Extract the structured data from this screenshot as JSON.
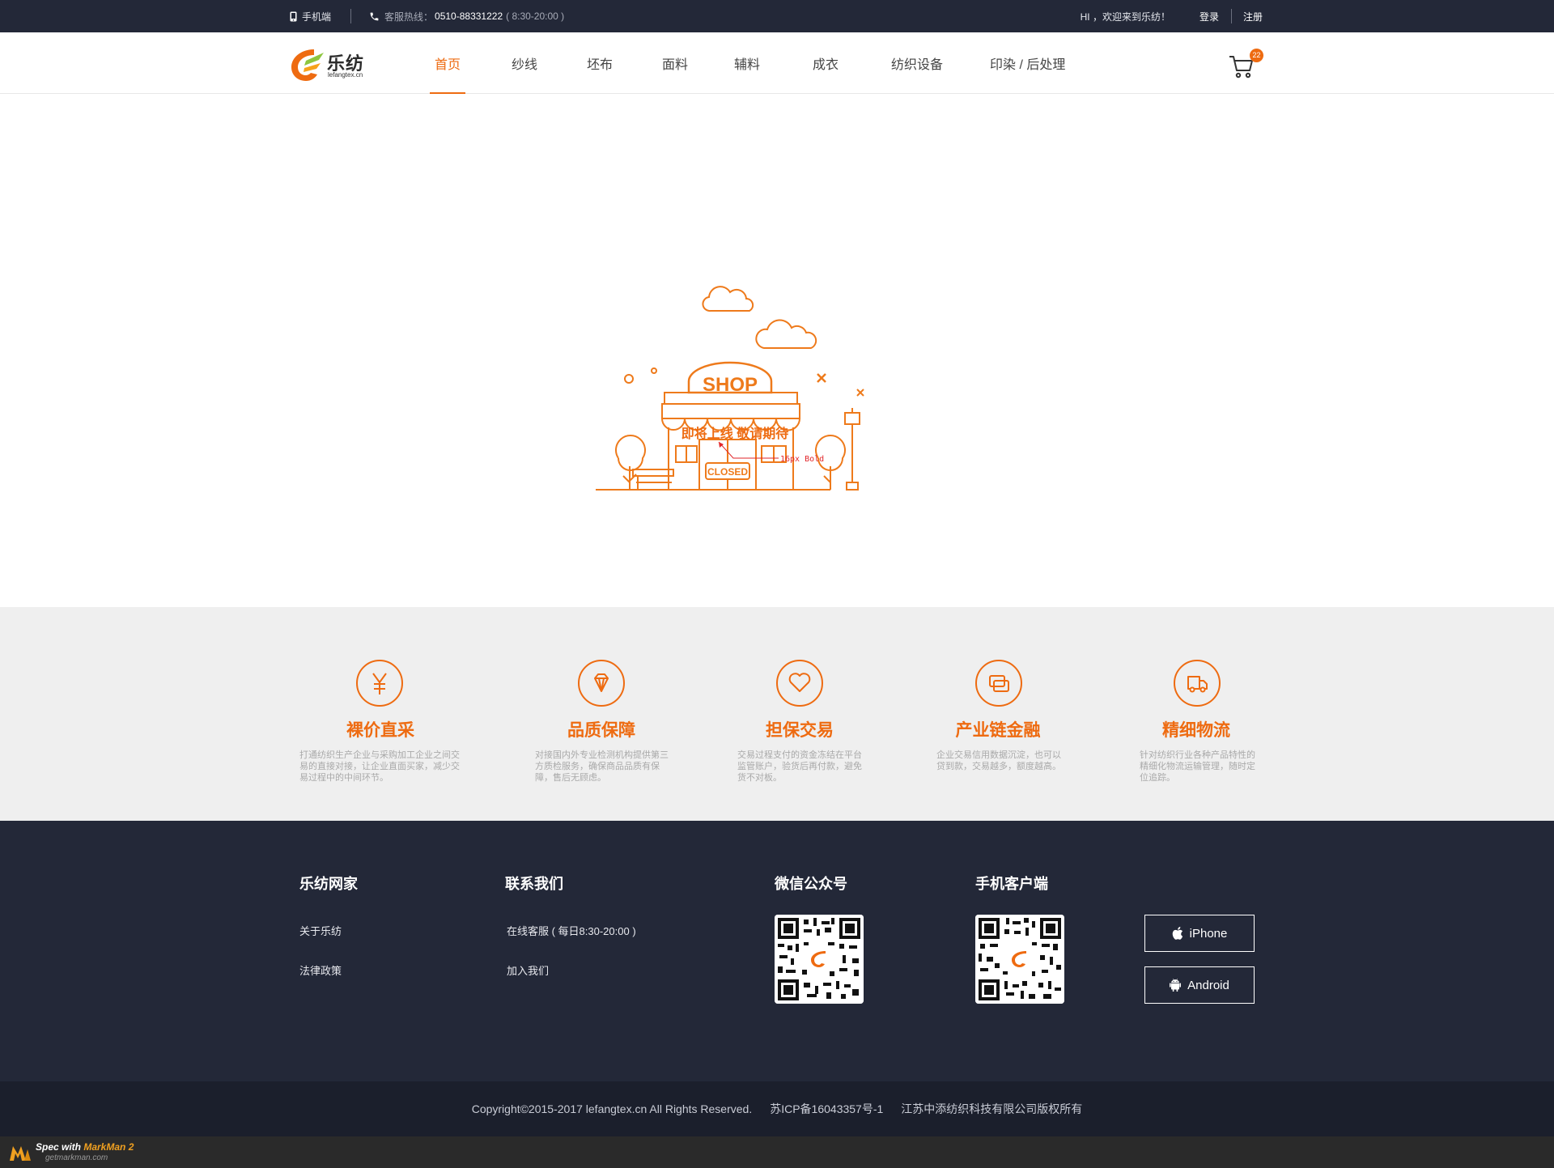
{
  "topbar": {
    "mobile_label": "手机端",
    "hotline_label": "客服热线：",
    "hotline_number": "0510-88331222",
    "hotline_hours": "( 8:30-20:00 )",
    "welcome": "HI ，欢迎来到乐纺！",
    "login": "登录",
    "register": "注册"
  },
  "header": {
    "logo_cn": "乐纺",
    "logo_en": "lefangtex.cn",
    "nav": [
      "首页",
      "纱线",
      "坯布",
      "面料",
      "辅料",
      "成衣",
      "纺织设备",
      "印染 / 后处理"
    ],
    "active_nav": "首页",
    "cart_count": "22"
  },
  "main": {
    "shop_sign": "SHOP",
    "closed_sign": "CLOSED",
    "coming_soon": "即将上线 敬请期待",
    "annotation": "16px Bold"
  },
  "features": [
    {
      "title": "裸价直采",
      "desc": "打通纺织生产企业与采购加工企业之间交易的直接对接，让企业直面买家，减少交易过程中的中间环节。",
      "icon": "yen-icon"
    },
    {
      "title": "品质保障",
      "desc": "对接国内外专业检测机构提供第三方质检服务，确保商品品质有保障，售后无顾虑。",
      "icon": "diamond-icon"
    },
    {
      "title": "担保交易",
      "desc": "交易过程支付的资金冻结在平台监管账户，验货后再付款，避免货不对板。",
      "icon": "heart-icon"
    },
    {
      "title": "产业链金融",
      "desc": "企业交易信用数据沉淀，也可以贷到款，交易越多，额度越高。",
      "icon": "finance-icon"
    },
    {
      "title": "精细物流",
      "desc": "针对纺织行业各种产品特性的精细化物流运输管理，随时定位追踪。",
      "icon": "truck-icon"
    }
  ],
  "footer": {
    "col1_title": "乐纺网家",
    "col1_links": [
      "关于乐纺",
      "法律政策"
    ],
    "col2_title": "联系我们",
    "col2_links": [
      "在线客服 ( 每日8:30-20:00 )",
      "加入我们"
    ],
    "wechat_title": "微信公众号",
    "app_title": "手机客户端",
    "iphone": "iPhone",
    "android": "Android"
  },
  "copyright": {
    "text": "Copyright©2015-2017 lefangtex.cn  All Rights Reserved.",
    "icp": "苏ICP备16043357号-1",
    "company": "江苏中添纺织科技有限公司版权所有"
  },
  "markman": {
    "line1_prefix": "Spec with ",
    "line1_brand": "MarkMan 2",
    "line2": "getmarkman.com"
  },
  "colors": {
    "accent": "#ee6b11",
    "dark": "#232838",
    "feature_bg": "#efefef"
  }
}
